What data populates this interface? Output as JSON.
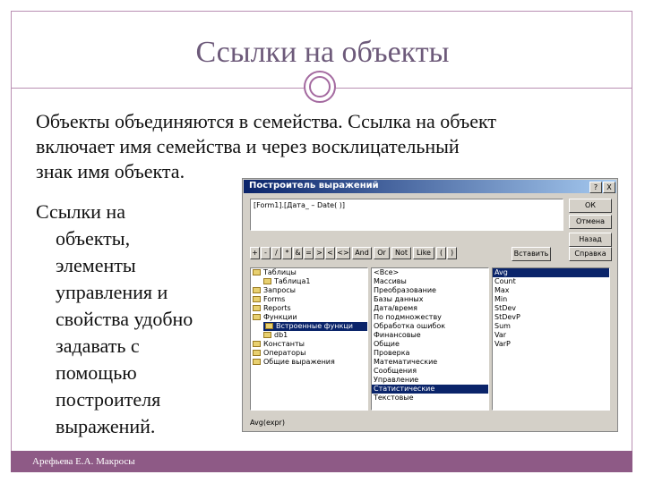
{
  "slide": {
    "title": "Ссылки на объекты",
    "body_lines": [
      "Объекты объединяются в семейства. Ссылка на объект",
      "включает имя семейства и через восклицательный",
      "знак имя объекта."
    ],
    "side_lines": [
      "Ссылки на",
      "объекты,",
      "элементы",
      "управления и",
      "свойства удобно",
      "задавать с",
      "помощью",
      "построителя",
      "выражений."
    ],
    "footer": "Арефьева Е.А. Макросы"
  },
  "dialog": {
    "title": "Построитель выражений",
    "title_buttons": [
      "?",
      "X"
    ],
    "expression": "[Form1].[Дата_ – Date( )]",
    "buttons": {
      "ok": "ОК",
      "cancel": "Отмена",
      "back": "Назад",
      "help": "Справка",
      "paste": "Вставить"
    },
    "operators": [
      "+",
      "-",
      "/",
      "*",
      "&",
      "=",
      ">",
      "<",
      "<>",
      "And",
      "Or",
      "Not",
      "Like",
      "(",
      ")"
    ],
    "left_pane": [
      {
        "label": "Таблицы",
        "indent": 0,
        "selected": false
      },
      {
        "label": "Таблица1",
        "indent": 1,
        "selected": false
      },
      {
        "label": "Запросы",
        "indent": 0,
        "selected": false
      },
      {
        "label": "Forms",
        "indent": 0,
        "selected": false
      },
      {
        "label": "Reports",
        "indent": 0,
        "selected": false
      },
      {
        "label": "Функции",
        "indent": 0,
        "selected": false
      },
      {
        "label": "Встроенные функци",
        "indent": 1,
        "selected": true
      },
      {
        "label": "db1",
        "indent": 1,
        "selected": false
      },
      {
        "label": "Константы",
        "indent": 0,
        "selected": false
      },
      {
        "label": "Операторы",
        "indent": 0,
        "selected": false
      },
      {
        "label": "Общие выражения",
        "indent": 0,
        "selected": false
      }
    ],
    "middle_pane": [
      "<Все>",
      "Массивы",
      "Преобразование",
      "Базы данных",
      "Дата/время",
      "По подмножеству",
      "Обработка ошибок",
      "Финансовые",
      "Общие",
      "Проверка",
      "Математические",
      "Сообщения",
      "Управление",
      "Статистические",
      "Текстовые"
    ],
    "middle_selected": "Статистические",
    "right_pane": [
      "Avg",
      "Count",
      "Max",
      "Min",
      "StDev",
      "StDevP",
      "Sum",
      "Var",
      "VarP"
    ],
    "right_selected": "Avg",
    "status": "Avg(expr)"
  }
}
